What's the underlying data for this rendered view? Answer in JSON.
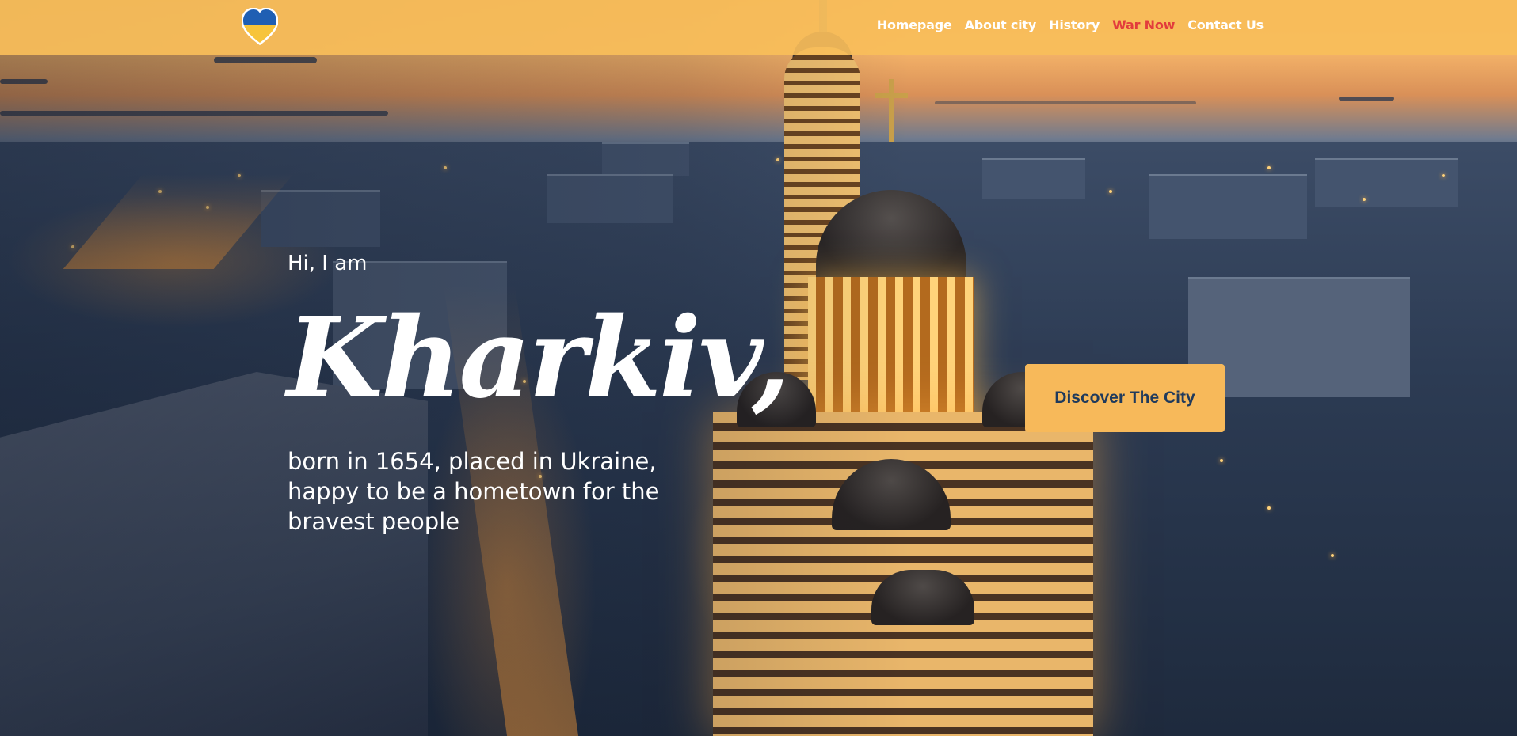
{
  "header": {
    "logo_icon": "ukraine-heart-icon",
    "nav": [
      {
        "label": "Homepage"
      },
      {
        "label": "About city"
      },
      {
        "label": "History"
      },
      {
        "label": "War Now"
      },
      {
        "label": "Contact Us"
      }
    ],
    "active_item": "War Now",
    "colors": {
      "bar": "#f9be5a",
      "active": "#e23c3c",
      "text": "#ffffff"
    }
  },
  "hero": {
    "greeting": "Hi, I am",
    "title": "Kharkiv,",
    "tagline": "born in 1654, placed in Ukraine, happy to be a hometown for the bravest people",
    "cta_label": "Discover The City",
    "cta_colors": {
      "background": "#f7b95a",
      "text": "#1f3a5c"
    }
  },
  "background_image": "aerial-night-city-cathedral"
}
